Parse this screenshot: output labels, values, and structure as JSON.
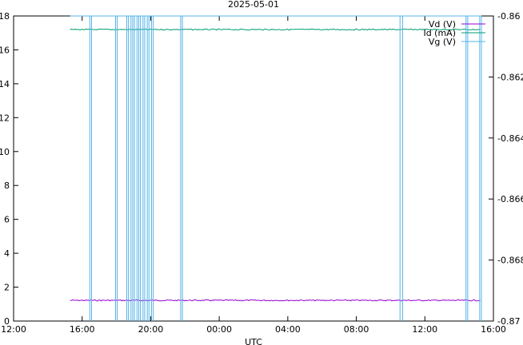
{
  "chart_data": {
    "type": "line",
    "title": "2025-05-01",
    "xlabel": "UTC",
    "ylabel": "",
    "ylabel_right": "",
    "x_ticks": [
      "12:00",
      "16:00",
      "20:00",
      "00:00",
      "04:00",
      "08:00",
      "12:00",
      "16:00"
    ],
    "xlim_hours": [
      12,
      40
    ],
    "ylim_left": [
      0,
      18
    ],
    "y_ticks_left": [
      0,
      2,
      4,
      6,
      8,
      10,
      12,
      14,
      16,
      18
    ],
    "ylim_right": [
      -0.87,
      -0.86
    ],
    "y_ticks_right": [
      "-0.87",
      "-0.868",
      "-0.866",
      "-0.864",
      "-0.862",
      "-0.86"
    ],
    "grid": false,
    "legend_position": "top-right",
    "series": [
      {
        "name": "Vd (V)",
        "axis": "left",
        "color": "#9400d3",
        "x_range_hours": [
          15.3,
          39.3
        ],
        "value": 1.22
      },
      {
        "name": "Id (mA)",
        "axis": "left",
        "color": "#009e73",
        "x_range_hours": [
          15.3,
          39.3
        ],
        "value": 17.2
      },
      {
        "name": "Vg (V)",
        "axis": "right",
        "color": "#56b4e9",
        "x_range_hours": [
          15.3,
          39.3
        ],
        "value": -0.86,
        "spike_times_hours": [
          16.45,
          16.55,
          17.95,
          18.05,
          18.6,
          18.7,
          18.85,
          18.95,
          19.05,
          19.2,
          19.3,
          19.4,
          19.55,
          19.65,
          19.8,
          19.9,
          20.05,
          20.15,
          21.75,
          21.85,
          34.55,
          34.7,
          38.4,
          38.5,
          39.2,
          39.3
        ],
        "spike_min": -0.87
      }
    ]
  }
}
